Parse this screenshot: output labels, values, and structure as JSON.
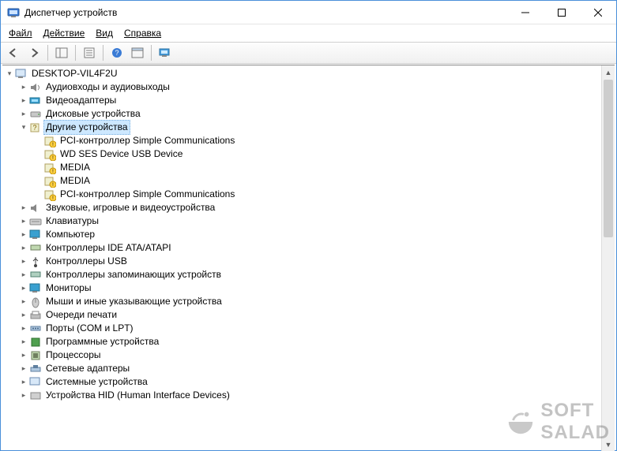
{
  "window": {
    "title": "Диспетчер устройств"
  },
  "menu": {
    "file": "Файл",
    "action": "Действие",
    "view": "Вид",
    "help": "Справка"
  },
  "tree": {
    "root": "DESKTOP-VIL4F2U",
    "cat": {
      "audio": "Аудиовходы и аудиовыходы",
      "video": "Видеоадаптеры",
      "disk": "Дисковые устройства",
      "other": "Другие устройства",
      "sound": "Звуковые, игровые и видеоустройства",
      "keyboard": "Клавиатуры",
      "computer": "Компьютер",
      "ide": "Контроллеры IDE ATA/ATAPI",
      "usb": "Контроллеры USB",
      "storage": "Контроллеры запоминающих устройств",
      "monitor": "Мониторы",
      "mouse": "Мыши и иные указывающие устройства",
      "printq": "Очереди печати",
      "ports": "Порты (COM и LPT)",
      "software": "Программные устройства",
      "cpu": "Процессоры",
      "net": "Сетевые адаптеры",
      "system": "Системные устройства",
      "hid": "Устройства HID (Human Interface Devices)"
    },
    "other_children": {
      "c0": "PCI-контроллер Simple Communications",
      "c1": "WD SES Device USB Device",
      "c2": "MEDIA",
      "c3": "MEDIA",
      "c4": "PCI-контроллер Simple Communications"
    }
  },
  "watermark": {
    "line1": "SOFT",
    "line2": "SALAD"
  }
}
